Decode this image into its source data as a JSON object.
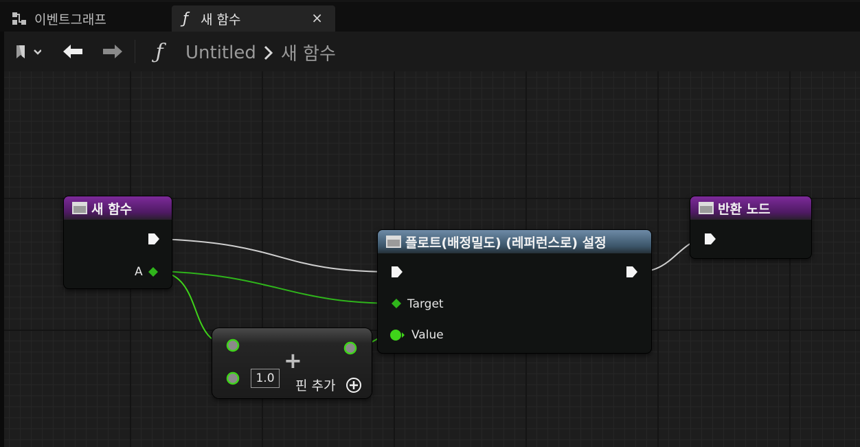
{
  "tabs": [
    {
      "label": "이벤트그래프",
      "icon": "event-graph-icon"
    },
    {
      "label": "새 함수",
      "icon": "function-icon",
      "close": "×"
    }
  ],
  "toolbar": {
    "breadcrumb_root": "Untitled",
    "breadcrumb_current": "새 함수",
    "function_glyph": "ƒ"
  },
  "nodes": {
    "entry": {
      "title": "새 함수",
      "pin_a": "A",
      "color": "#7d2a9a"
    },
    "setter": {
      "title": "플로트(배정밀도) (레퍼런스로) 설정",
      "pin_target": "Target",
      "pin_value": "Value",
      "color": "#6d8aa6"
    },
    "return": {
      "title": "반환 노드",
      "color": "#7d2a9a"
    },
    "add": {
      "value": "1.0",
      "add_pin": "핀 추가",
      "plus": "+"
    }
  },
  "colors": {
    "exec_wire": "#cfcfcf",
    "float_wire": "#3fd41a",
    "ref_wire": "#2fb51b"
  }
}
